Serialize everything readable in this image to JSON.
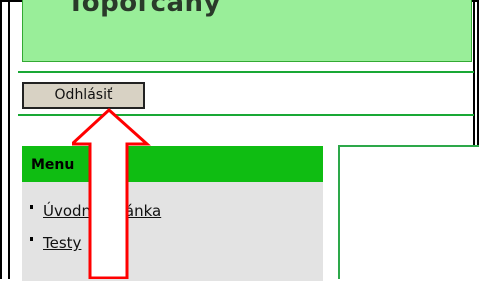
{
  "header": {
    "title": "Topoľčany"
  },
  "toolbar": {
    "logout_label": "Odhlásiť"
  },
  "menu": {
    "title": "Menu",
    "items": [
      {
        "label": "Úvodná stránka"
      },
      {
        "label": "Testy"
      }
    ]
  },
  "annotation": {
    "arrow_color": "#ff0000",
    "arrow_direction": "up"
  },
  "colors": {
    "banner": "#99ee99",
    "menu_header": "#0fbd12",
    "menu_background": "#e3e3e3",
    "button_background": "#d8d2c4",
    "divider": "#19a835"
  }
}
